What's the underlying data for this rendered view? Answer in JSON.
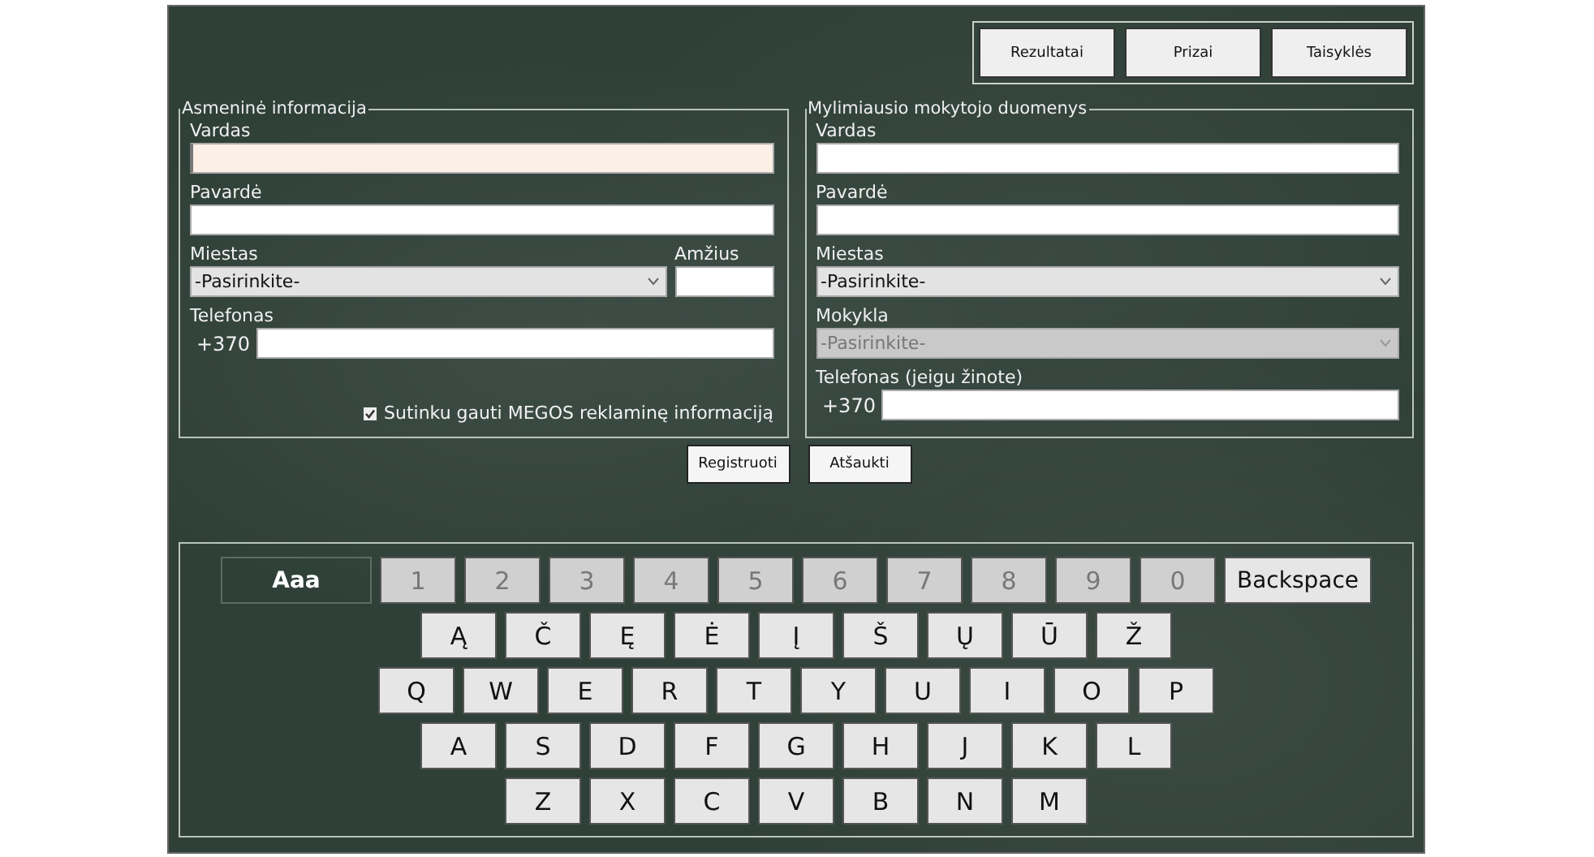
{
  "nav_buttons": [
    "Rezultatai",
    "Prizai",
    "Taisyklės"
  ],
  "panels": [
    {
      "title": "Asmeninė informacija",
      "rows": [
        [
          {
            "kind": "text",
            "label": "Vardas",
            "focused": true
          }
        ],
        [
          {
            "kind": "text",
            "label": "Pavardė",
            "focused": false
          }
        ],
        [
          {
            "kind": "select",
            "label": "Miestas",
            "value": "-Pasirinkite-",
            "disabled": false
          },
          {
            "kind": "text",
            "label": "Amžius",
            "focused": false
          }
        ],
        [
          {
            "kind": "phone",
            "label": "Telefonas",
            "prefix": "+370"
          }
        ]
      ],
      "consent": {
        "label": "Sutinku gauti MEGOS reklaminę informaciją",
        "checked": true
      }
    },
    {
      "title": "Mylimiausio mokytojo duomenys",
      "rows": [
        [
          {
            "kind": "text",
            "label": "Vardas",
            "focused": false
          }
        ],
        [
          {
            "kind": "text",
            "label": "Pavardė",
            "focused": false
          }
        ],
        [
          {
            "kind": "select",
            "label": "Miestas",
            "value": "-Pasirinkite-",
            "disabled": false
          }
        ],
        [
          {
            "kind": "select",
            "label": "Mokykla",
            "value": "-Pasirinkite-",
            "disabled": true
          }
        ],
        [
          {
            "kind": "phone",
            "label": "Telefonas (jeigu žinote)",
            "prefix": "+370"
          }
        ]
      ]
    }
  ],
  "actions": [
    "Registruoti",
    "Atšaukti"
  ],
  "keyboard": {
    "key_lines": [
      [
        {
          "kind": "toggle",
          "label": "Aaa"
        },
        {
          "kind": "key",
          "label": "1",
          "disabled": true
        },
        {
          "kind": "key",
          "label": "2",
          "disabled": true
        },
        {
          "kind": "key",
          "label": "3",
          "disabled": true
        },
        {
          "kind": "key",
          "label": "4",
          "disabled": true
        },
        {
          "kind": "key",
          "label": "5",
          "disabled": true
        },
        {
          "kind": "key",
          "label": "6",
          "disabled": true
        },
        {
          "kind": "key",
          "label": "7",
          "disabled": true
        },
        {
          "kind": "key",
          "label": "8",
          "disabled": true
        },
        {
          "kind": "key",
          "label": "9",
          "disabled": true
        },
        {
          "kind": "key",
          "label": "0",
          "disabled": true
        },
        {
          "kind": "wide",
          "label": "Backspace",
          "disabled": false
        }
      ],
      [
        {
          "kind": "key",
          "label": "Ą",
          "disabled": false
        },
        {
          "kind": "key",
          "label": "Č",
          "disabled": false
        },
        {
          "kind": "key",
          "label": "Ę",
          "disabled": false
        },
        {
          "kind": "key",
          "label": "Ė",
          "disabled": false
        },
        {
          "kind": "key",
          "label": "Į",
          "disabled": false
        },
        {
          "kind": "key",
          "label": "Š",
          "disabled": false
        },
        {
          "kind": "key",
          "label": "Ų",
          "disabled": false
        },
        {
          "kind": "key",
          "label": "Ū",
          "disabled": false
        },
        {
          "kind": "key",
          "label": "Ž",
          "disabled": false
        }
      ],
      [
        {
          "kind": "key",
          "label": "Q",
          "disabled": false
        },
        {
          "kind": "key",
          "label": "W",
          "disabled": false
        },
        {
          "kind": "key",
          "label": "E",
          "disabled": false
        },
        {
          "kind": "key",
          "label": "R",
          "disabled": false
        },
        {
          "kind": "key",
          "label": "T",
          "disabled": false
        },
        {
          "kind": "key",
          "label": "Y",
          "disabled": false
        },
        {
          "kind": "key",
          "label": "U",
          "disabled": false
        },
        {
          "kind": "key",
          "label": "I",
          "disabled": false
        },
        {
          "kind": "key",
          "label": "O",
          "disabled": false
        },
        {
          "kind": "key",
          "label": "P",
          "disabled": false
        }
      ],
      [
        {
          "kind": "key",
          "label": "A",
          "disabled": false
        },
        {
          "kind": "key",
          "label": "S",
          "disabled": false
        },
        {
          "kind": "key",
          "label": "D",
          "disabled": false
        },
        {
          "kind": "key",
          "label": "F",
          "disabled": false
        },
        {
          "kind": "key",
          "label": "G",
          "disabled": false
        },
        {
          "kind": "key",
          "label": "H",
          "disabled": false
        },
        {
          "kind": "key",
          "label": "J",
          "disabled": false
        },
        {
          "kind": "key",
          "label": "K",
          "disabled": false
        },
        {
          "kind": "key",
          "label": "L",
          "disabled": false
        }
      ],
      [
        {
          "kind": "key",
          "label": "Z",
          "disabled": false
        },
        {
          "kind": "key",
          "label": "X",
          "disabled": false
        },
        {
          "kind": "key",
          "label": "C",
          "disabled": false
        },
        {
          "kind": "key",
          "label": "V",
          "disabled": false
        },
        {
          "kind": "key",
          "label": "B",
          "disabled": false
        },
        {
          "kind": "key",
          "label": "N",
          "disabled": false
        },
        {
          "kind": "key",
          "label": "M",
          "disabled": false
        }
      ]
    ]
  }
}
